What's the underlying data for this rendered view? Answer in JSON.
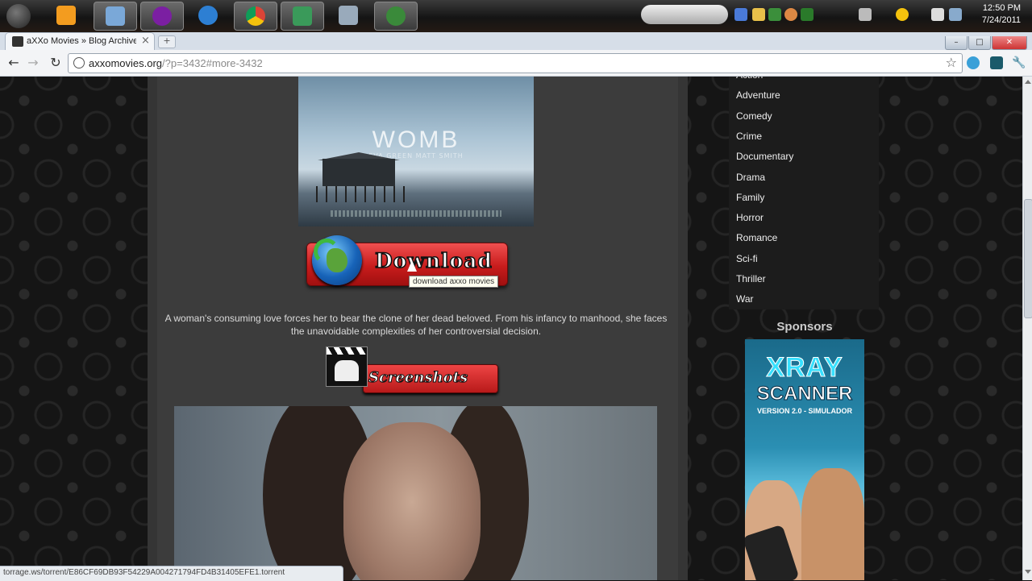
{
  "taskbar": {
    "clock_time": "12:50 PM",
    "clock_date": "7/24/2011"
  },
  "browser": {
    "tab_title": "aXXo Movies » Blog Archive",
    "tab_close": "×",
    "new_tab": "+",
    "url_host": "axxomovies.org",
    "url_path": "/?p=3432#more-3432",
    "status_url": "torrage.ws/torrent/E86CF69DB93F54229A004271794FD4B31405EFE1.torrent"
  },
  "post": {
    "poster_title": "WOMB",
    "poster_cast": "EVA GREEN   MATT SMITH",
    "download_label": "Download",
    "download_tooltip": "download axxo movies",
    "synopsis": "A woman's consuming love forces her to bear the clone of her dead beloved. From his infancy to manhood, she faces the unavoidable complexities of her controversial decision.",
    "screenshots_label": "Screenshots"
  },
  "sidebar": {
    "categories": [
      "Action",
      "Adventure",
      "Comedy",
      "Crime",
      "Documentary",
      "Drama",
      "Family",
      "Horror",
      "Romance",
      "Sci-fi",
      "Thriller",
      "War"
    ],
    "sponsors_title": "Sponsors",
    "ad": {
      "line1": "XRAY",
      "line2": "SCANNER",
      "line3": "VERSION 2.0 - SIMULADOR"
    }
  },
  "colors": {
    "download_red": "#c81c1c",
    "page_bg": "#151515",
    "content_bg": "#3c3c3c"
  }
}
